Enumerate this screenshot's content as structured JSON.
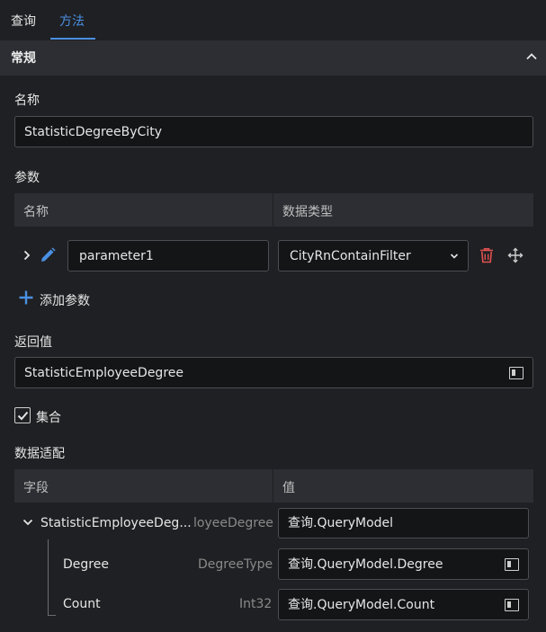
{
  "tabs": [
    {
      "label": "查询"
    },
    {
      "label": "方法"
    }
  ],
  "section": {
    "title": "常规"
  },
  "name_field": {
    "label": "名称",
    "value": "StatisticDegreeByCity"
  },
  "params": {
    "label": "参数",
    "columns": [
      "名称",
      "数据类型"
    ],
    "rows": [
      {
        "name": "parameter1",
        "type": "CityRnContainFilter"
      }
    ],
    "add_label": "添加参数"
  },
  "return_value": {
    "label": "返回值",
    "value": "StatisticEmployeeDegree"
  },
  "collection": {
    "label": "集合",
    "checked": true
  },
  "mapping": {
    "label": "数据适配",
    "columns": [
      "字段",
      "值"
    ],
    "root": {
      "name": "StatisticEmployeeDeg...",
      "type": "loyeeDegree",
      "value": "查询.QueryModel"
    },
    "children": [
      {
        "name": "Degree",
        "type": "DegreeType",
        "value": "查询.QueryModel.Degree"
      },
      {
        "name": "Count",
        "type": "Int32",
        "value": "查询.QueryModel.Count"
      }
    ]
  },
  "colors": {
    "accent": "#4a90e2",
    "delete": "#e05252"
  }
}
